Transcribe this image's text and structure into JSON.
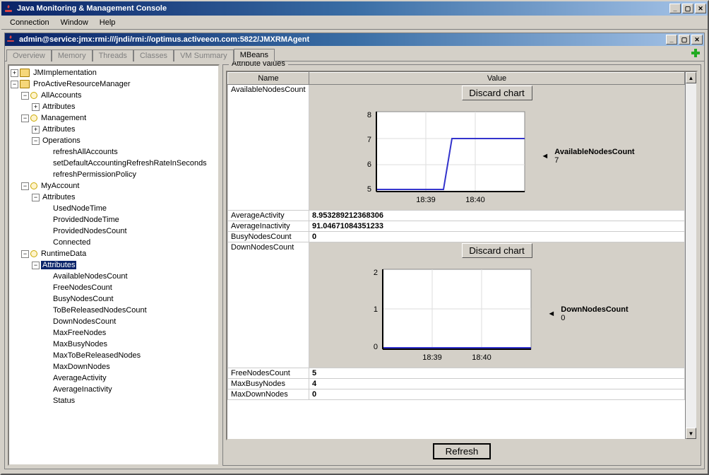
{
  "window": {
    "title": "Java Monitoring & Management Console"
  },
  "menu": {
    "connection": "Connection",
    "window": "Window",
    "help": "Help"
  },
  "subwindow": {
    "title": "admin@service:jmx:rmi:///jndi/rmi://optimus.activeeon.com:5822/JMXRMAgent"
  },
  "tabs": {
    "overview": "Overview",
    "memory": "Memory",
    "threads": "Threads",
    "classes": "Classes",
    "vmsummary": "VM Summary",
    "mbeans": "MBeans"
  },
  "tree": {
    "root1": "JMImplementation",
    "root2": "ProActiveResourceManager",
    "allAccounts": "AllAccounts",
    "attributes": "Attributes",
    "operations": "Operations",
    "refreshAllAccounts": "refreshAllAccounts",
    "setDefault": "setDefaultAccountingRefreshRateInSeconds",
    "refreshPermPolicy": "refreshPermissionPolicy",
    "management": "Management",
    "myAccount": "MyAccount",
    "usedNodeTime": "UsedNodeTime",
    "providedNodeTime": "ProvidedNodeTime",
    "providedNodesCount": "ProvidedNodesCount",
    "connected": "Connected",
    "runtimeData": "RuntimeData",
    "availableNodesCount": "AvailableNodesCount",
    "freeNodesCount": "FreeNodesCount",
    "busyNodesCount": "BusyNodesCount",
    "toBeReleased": "ToBeReleasedNodesCount",
    "downNodesCount": "DownNodesCount",
    "maxFreeNodes": "MaxFreeNodes",
    "maxBusyNodes": "MaxBusyNodes",
    "maxToBeReleased": "MaxToBeReleasedNodes",
    "maxDownNodes": "MaxDownNodes",
    "averageActivity": "AverageActivity",
    "averageInactivity": "AverageInactivity",
    "status": "Status"
  },
  "panel": {
    "legend": "Attribute values",
    "colName": "Name",
    "colValue": "Value",
    "discard": "Discard chart",
    "refresh": "Refresh"
  },
  "rows": {
    "r1_name": "AvailableNodesCount",
    "r2_name": "AverageActivity",
    "r2_val": "8.953289212368306",
    "r3_name": "AverageInactivity",
    "r3_val": "91.04671084351233",
    "r4_name": "BusyNodesCount",
    "r4_val": "0",
    "r5_name": "DownNodesCount",
    "r6_name": "FreeNodesCount",
    "r6_val": "5",
    "r7_name": "MaxBusyNodes",
    "r7_val": "4",
    "r8_name": "MaxDownNodes",
    "r8_val": "0"
  },
  "chart_data": [
    {
      "type": "line",
      "title": "AvailableNodesCount",
      "current_value": 7,
      "x_ticks": [
        "18:39",
        "18:40"
      ],
      "y_ticks": [
        5,
        6,
        7,
        8
      ],
      "ylim": [
        5,
        8
      ],
      "series": [
        {
          "name": "AvailableNodesCount",
          "values": [
            5,
            5,
            5,
            5,
            7,
            7,
            7
          ],
          "note": "step from 5 to 7 around midpoint"
        }
      ]
    },
    {
      "type": "line",
      "title": "DownNodesCount",
      "current_value": 0,
      "x_ticks": [
        "18:39",
        "18:40"
      ],
      "y_ticks": [
        0,
        1,
        2
      ],
      "ylim": [
        0,
        2
      ],
      "series": [
        {
          "name": "DownNodesCount",
          "values": [
            0,
            0,
            0,
            0,
            0,
            0,
            0
          ]
        }
      ]
    }
  ],
  "chart1": {
    "label": "AvailableNodesCount",
    "val": "7",
    "y1": "5",
    "y2": "6",
    "y3": "7",
    "y4": "8",
    "x1": "18:39",
    "x2": "18:40"
  },
  "chart2": {
    "label": "DownNodesCount",
    "val": "0",
    "y1": "0",
    "y2": "1",
    "y3": "2",
    "x1": "18:39",
    "x2": "18:40"
  }
}
